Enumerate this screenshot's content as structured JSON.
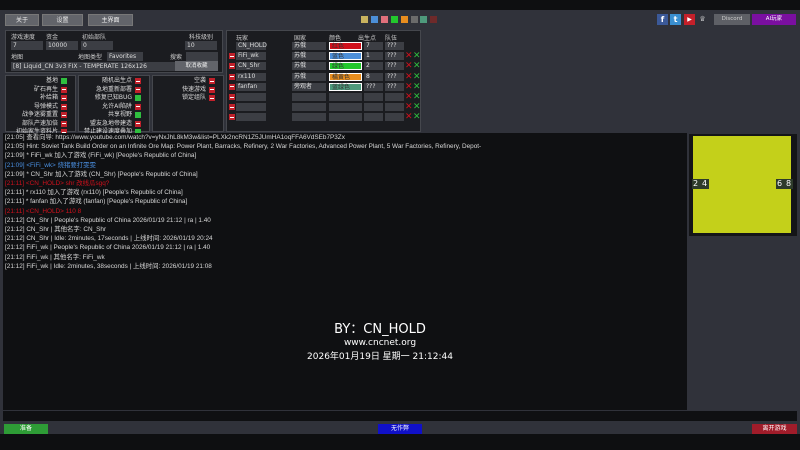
{
  "top_buttons": {
    "about": "关于",
    "settings": "设置",
    "main_menu": "主界面"
  },
  "color_swatches": [
    "#c9b35f",
    "#4c8fd8",
    "#e0707c",
    "#23c82d",
    "#e88d1e",
    "#6b6b6b",
    "#4e9a7c",
    "#6e2a2a"
  ],
  "social": {
    "facebook": "f",
    "twitter": "t",
    "youtube": "▶",
    "discord": "Discord",
    "ai_player": "AI玩家"
  },
  "settings": {
    "game_speed_label": "游戏速度",
    "game_speed": "7",
    "credits_label": "资金",
    "credits": "10000",
    "start_units_label": "初始部队",
    "start_units": "0",
    "tech_level_label": "科技级别",
    "tech_level": "10",
    "map_label": "地图",
    "map_type_label": "地图类型",
    "map_type": "Favorites",
    "search_label": "搜索",
    "search_value": "",
    "map_name": "[8] Liquid_CN 3v3 FIX - TEMPERATE 126x126",
    "unfavorite": "取消收藏"
  },
  "options": [
    [
      {
        "label": "基地",
        "on": true
      },
      {
        "label": "矿石再生",
        "on": false
      },
      {
        "label": "补给箱",
        "on": false
      },
      {
        "label": "导弹模式",
        "on": false
      },
      {
        "label": "战争迷雾重置",
        "on": false
      },
      {
        "label": "部队产速加倍",
        "on": false
      },
      {
        "label": "初始家生资料片",
        "on": false
      }
    ],
    [
      {
        "label": "随机出生点",
        "on": false
      },
      {
        "label": "急地重新部署",
        "on": false
      },
      {
        "label": "修复已知BUG",
        "on": true
      },
      {
        "label": "允许AI陷阱",
        "on": false
      },
      {
        "label": "共享视野",
        "on": true
      },
      {
        "label": "盟友急地帝建造",
        "on": false
      },
      {
        "label": "禁止建设速度叠加",
        "on": true
      }
    ],
    [
      {
        "label": "空袭",
        "on": false
      },
      {
        "label": "快速游戏",
        "on": false
      },
      {
        "label": "锁定组队",
        "on": false
      }
    ]
  ],
  "players": {
    "headers": {
      "player": "玩家",
      "country": "国家",
      "color": "颜色",
      "start": "出生点",
      "team": "队伍"
    },
    "rows": [
      {
        "name": "CN_HOLD",
        "country": "苏俄",
        "color": "红色",
        "color_hex": "#d0101c",
        "start": "7",
        "team": "???",
        "host": true
      },
      {
        "name": "FiFi_wk",
        "country": "苏俄",
        "color": "蓝色",
        "color_hex": "#4c8fd8",
        "start": "1",
        "team": "???"
      },
      {
        "name": "CN_Shr",
        "country": "苏俄",
        "color": "绿色",
        "color_hex": "#23c82d",
        "start": "2",
        "team": "???"
      },
      {
        "name": "rx110",
        "country": "苏俄",
        "color": "橘黄色",
        "color_hex": "#e88d1e",
        "start": "8",
        "team": "???"
      },
      {
        "name": "fanfan",
        "country": "旁观者",
        "color": "蓝绿色",
        "color_hex": "#4e9a7c",
        "start": "???",
        "team": "???"
      },
      {
        "name": "",
        "country": "",
        "color": "",
        "color_hex": "",
        "start": "",
        "team": ""
      },
      {
        "name": "",
        "country": "",
        "color": "",
        "color_hex": "",
        "start": "",
        "team": ""
      },
      {
        "name": "",
        "country": "",
        "color": "",
        "color_hex": "",
        "start": "",
        "team": ""
      }
    ]
  },
  "chat": [
    {
      "text": "[21:05] 查看向导: https://www.youtube.com/watch?v=yNxJhL8kM3w&list=PLXk2ncRN1Z5JUmHA1oqFFA6VdSEb7P3Zx",
      "color": "#d8d8d8"
    },
    {
      "text": "[21:05] Hint: Soviet Tank Build Order on an Infinite Ore Map: Power Plant, Barracks, Refinery, 2 War Factories, Advanced Power Plant, 5 War Factories, Refinery, Depot-",
      "color": "#d8d8d8"
    },
    {
      "text": "[21:09] * FiFi_wk 加入了游戏 (FiFi_wk) [People's Republic of China]",
      "color": "#d8d8d8"
    },
    {
      "text": "[21:09] <FiFi_wk> 烧猪要打雯雯",
      "color": "#4a8fe0"
    },
    {
      "text": "[21:09] * CN_Shr 加入了游戏 (CN_Shr) [People's Republic of China]",
      "color": "#d8d8d8"
    },
    {
      "text": "[21:11] <CN_HOLD> shr 改线瓜sgq?",
      "color": "#d0101c"
    },
    {
      "text": "[21:11] * rx110 加入了游戏 (rx110) [People's Republic of China]",
      "color": "#d8d8d8"
    },
    {
      "text": "[21:11] * fanfan 加入了游戏 (fanfan) [People's Republic of China]",
      "color": "#d8d8d8"
    },
    {
      "text": "[21:11] <CN_HOLD> 110 8",
      "color": "#d0101c"
    },
    {
      "text": "[21:12] CN_Shr | People's Republic of China 2026/01/19 21:12 | ra | 1.40",
      "color": "#d8d8d8"
    },
    {
      "text": "[21:12] CN_Shr | 其他名字: CN_Shr",
      "color": "#d8d8d8"
    },
    {
      "text": "[21:12] CN_Shr | Idle: 2minutes, 17seconds | 上线时间: 2026/01/19 20:24",
      "color": "#d8d8d8"
    },
    {
      "text": "[21:12] FiFi_wk | People's Republic of China 2026/01/19 21:12 | ra | 1.40",
      "color": "#d8d8d8"
    },
    {
      "text": "[21:12] FiFi_wk | 其他名字: FiFi_wk",
      "color": "#d8d8d8"
    },
    {
      "text": "[21:12] FiFi_wk | Idle: 2minutes, 38seconds | 上线时间: 2026/01/19 21:08",
      "color": "#d8d8d8"
    }
  ],
  "overlay": {
    "by": "BY：CN_HOLD",
    "site": "www.cncnet.org",
    "datetime": "2026年01月19日 星期一 21:12:44"
  },
  "map_preview": {
    "start_points": [
      "2",
      "4",
      "6",
      "8"
    ],
    "terrain_color": "#c4d01a"
  },
  "chat_input": {
    "value": ""
  },
  "bottom": {
    "ready": "准备",
    "anticheat": "无作弊",
    "leave": "离开游戏"
  }
}
